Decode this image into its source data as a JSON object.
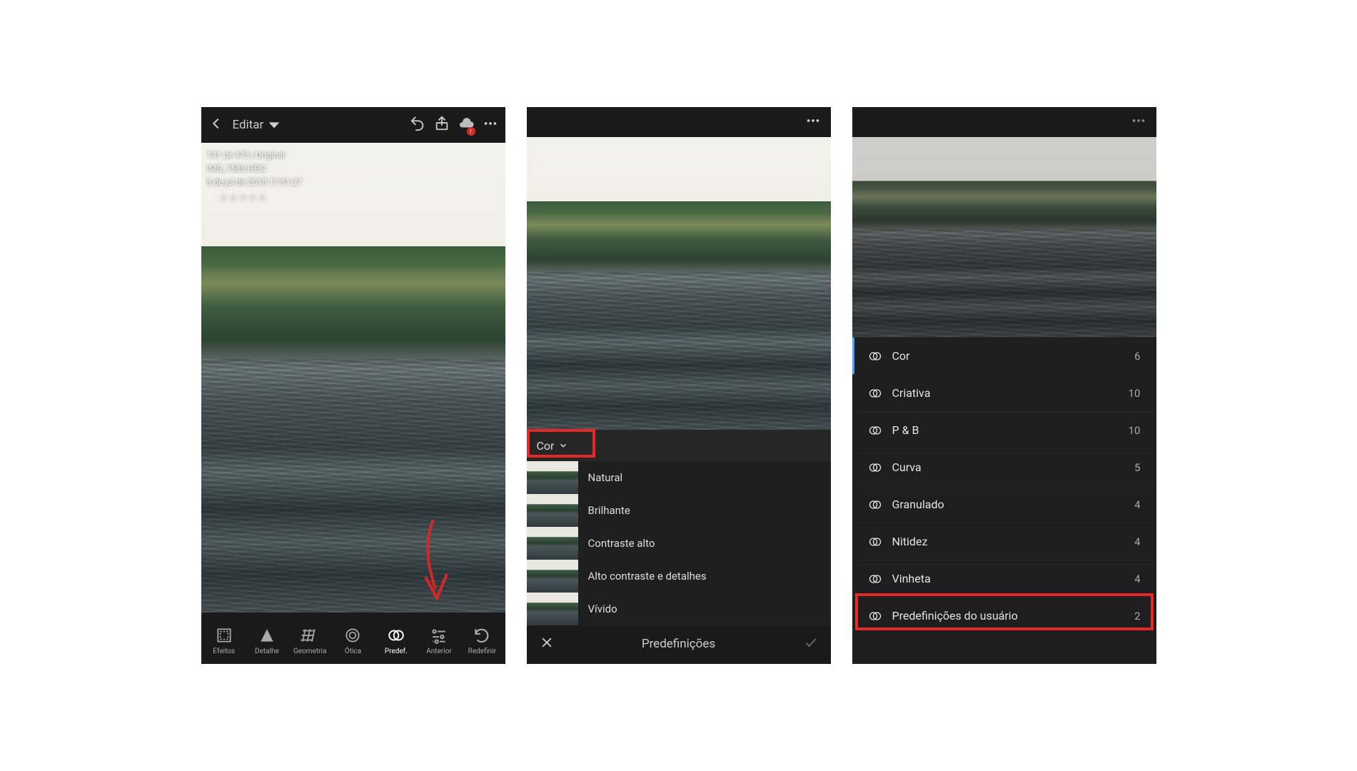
{
  "screen1": {
    "topbar": {
      "edit_label": "Editar"
    },
    "meta": {
      "line1": "131 de 473 | Original",
      "line2": "IMG_7585.HEIC",
      "line3": "8 de jul de 2018 17:51:27",
      "stars": "☆☆☆☆☆"
    },
    "tools": [
      {
        "label": "Efeitos"
      },
      {
        "label": "Detalhe"
      },
      {
        "label": "Geometria"
      },
      {
        "label": "Ótica"
      },
      {
        "label": "Predef."
      },
      {
        "label": "Anterior"
      },
      {
        "label": "Redefinir"
      }
    ]
  },
  "screen2": {
    "cor_label": "Cor",
    "presets": [
      "Natural",
      "Brilhante",
      "Contraste alto",
      "Alto contraste e detalhes",
      "Vívido"
    ],
    "footer_title": "Predefinições"
  },
  "screen3": {
    "categories": [
      {
        "label": "Cor",
        "count": "6"
      },
      {
        "label": "Criativa",
        "count": "10"
      },
      {
        "label": "P & B",
        "count": "10"
      },
      {
        "label": "Curva",
        "count": "5"
      },
      {
        "label": "Granulado",
        "count": "4"
      },
      {
        "label": "Nitidez",
        "count": "4"
      },
      {
        "label": "Vinheta",
        "count": "4"
      },
      {
        "label": "Predefinições do usuário",
        "count": "2"
      }
    ]
  }
}
